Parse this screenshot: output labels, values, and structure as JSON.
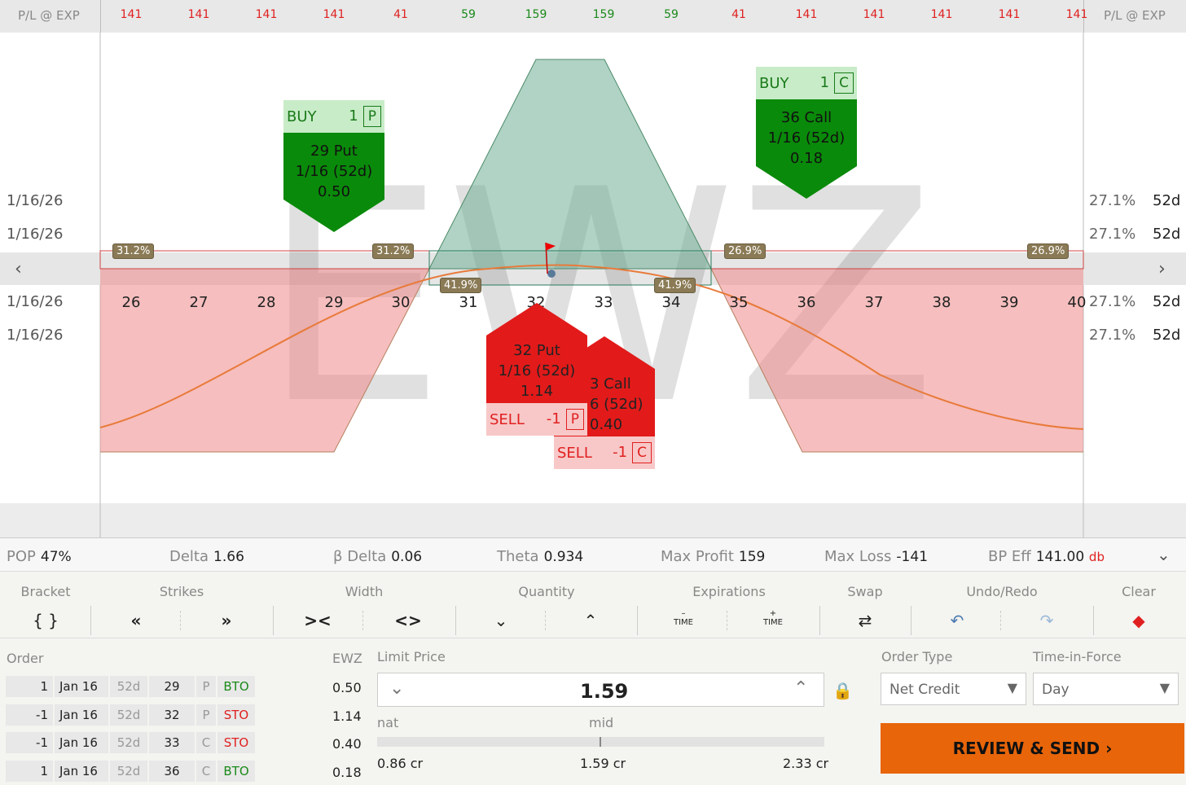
{
  "header": {
    "side_label": "P/L @ EXP",
    "pl": [
      {
        "v": "141",
        "c": "loss"
      },
      {
        "v": "141",
        "c": "loss"
      },
      {
        "v": "141",
        "c": "loss"
      },
      {
        "v": "141",
        "c": "loss"
      },
      {
        "v": "41",
        "c": "loss"
      },
      {
        "v": "59",
        "c": "gain"
      },
      {
        "v": "159",
        "c": "gain"
      },
      {
        "v": "159",
        "c": "gain"
      },
      {
        "v": "59",
        "c": "gain"
      },
      {
        "v": "41",
        "c": "loss"
      },
      {
        "v": "141",
        "c": "loss"
      },
      {
        "v": "141",
        "c": "loss"
      },
      {
        "v": "141",
        "c": "loss"
      },
      {
        "v": "141",
        "c": "loss"
      },
      {
        "v": "141",
        "c": "loss"
      }
    ]
  },
  "chart": {
    "symbol": "EWZ",
    "rows": [
      {
        "date": "1/16/26",
        "iv": "27.1%",
        "dte": "52d"
      },
      {
        "date": "1/16/26",
        "iv": "27.1%",
        "dte": "52d"
      },
      {
        "date": "1/16/26",
        "iv": "27.1%",
        "dte": "52d"
      },
      {
        "date": "1/16/26",
        "iv": "27.1%",
        "dte": "52d"
      }
    ],
    "strikes": [
      "26",
      "27",
      "28",
      "29",
      "30",
      "31",
      "32",
      "33",
      "34",
      "35",
      "36",
      "37",
      "38",
      "39",
      "40"
    ],
    "iv_tags": [
      "31.2%",
      "31.2%",
      "26.9%",
      "26.9%",
      "41.9%",
      "41.9%"
    ],
    "prev_icon": "chevron-left-icon",
    "next_icon": "chevron-right-icon",
    "legs": {
      "buy_put": {
        "action": "BUY",
        "qty": "1",
        "type": "P",
        "strike": "29 Put",
        "exp": "1/16 (52d)",
        "price": "0.50"
      },
      "buy_call": {
        "action": "BUY",
        "qty": "1",
        "type": "C",
        "strike": "36 Call",
        "exp": "1/16 (52d)",
        "price": "0.18"
      },
      "sell_put": {
        "action": "SELL",
        "qty": "-1",
        "type": "P",
        "strike": "32 Put",
        "exp": "1/16 (52d)",
        "price": "1.14"
      },
      "sell_call": {
        "action": "SELL",
        "qty": "-1",
        "type": "C",
        "strike": "3 Call",
        "exp": "6 (52d)",
        "price": "0.40"
      }
    }
  },
  "stats": {
    "pop_l": "POP",
    "pop": "47%",
    "delta_l": "Delta",
    "delta": "1.66",
    "bdelta_l": "β Delta",
    "bdelta": "0.06",
    "theta_l": "Theta",
    "theta": "0.934",
    "maxp_l": "Max Profit",
    "maxp": "159",
    "maxl_l": "Max Loss",
    "maxl": "-141",
    "bp_l": "BP Eff",
    "bp": "141.00",
    "bp_db": "db"
  },
  "tools": {
    "bracket": "Bracket",
    "strikes": "Strikes",
    "width": "Width",
    "quantity": "Quantity",
    "expirations": "Expirations",
    "swap": "Swap",
    "undo": "Undo/Redo",
    "clear": "Clear",
    "bracket_btn": "{ }",
    "time": "TIME",
    "minus": "–",
    "plus": "+"
  },
  "order": {
    "title": "Order",
    "sym": "EWZ",
    "rows": [
      {
        "q": "1",
        "exp": "Jan 16",
        "d": "52d",
        "k": "29",
        "t": "P",
        "a": "BTO",
        "p": "0.50"
      },
      {
        "q": "-1",
        "exp": "Jan 16",
        "d": "52d",
        "k": "32",
        "t": "P",
        "a": "STO",
        "p": "1.14"
      },
      {
        "q": "-1",
        "exp": "Jan 16",
        "d": "52d",
        "k": "33",
        "t": "C",
        "a": "STO",
        "p": "0.40"
      },
      {
        "q": "1",
        "exp": "Jan 16",
        "d": "52d",
        "k": "36",
        "t": "C",
        "a": "BTO",
        "p": "0.18"
      }
    ],
    "limit_label": "Limit Price",
    "limit": "1.59",
    "nat_label": "nat",
    "mid_label": "mid",
    "nat": "0.86 cr",
    "mid": "1.59 cr",
    "far": "2.33 cr",
    "type_label": "Order Type",
    "type": "Net Credit",
    "tif_label": "Time-in-Force",
    "tif": "Day",
    "submit": "REVIEW & SEND"
  }
}
